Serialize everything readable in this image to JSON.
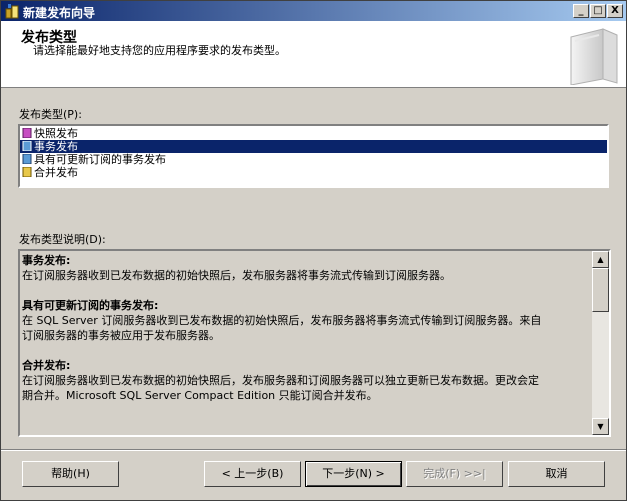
{
  "window": {
    "title": "新建发布向导",
    "controls": {
      "minimize": "_",
      "maximize": "□",
      "close": "X"
    }
  },
  "header": {
    "title": "发布类型",
    "subtitle": "请选择能最好地支持您的应用程序要求的发布类型。",
    "art_icon": "book-icon"
  },
  "publication_types": {
    "label": "发布类型(P):",
    "selected_index": 1,
    "items": [
      {
        "label": "快照发布",
        "icon": "snapshot-publication-icon"
      },
      {
        "label": "事务发布",
        "icon": "transactional-publication-icon"
      },
      {
        "label": "具有可更新订阅的事务发布",
        "icon": "updatable-transactional-publication-icon"
      },
      {
        "label": "合并发布",
        "icon": "merge-publication-icon"
      }
    ]
  },
  "description": {
    "label": "发布类型说明(D):",
    "sections": [
      {
        "heading": "事务发布:",
        "lines": [
          "在订阅服务器收到已发布数据的初始快照后，发布服务器将事务流式传输到订阅服务器。"
        ]
      },
      {
        "heading": "具有可更新订阅的事务发布:",
        "lines": [
          "在 SQL Server 订阅服务器收到已发布数据的初始快照后，发布服务器将事务流式传输到订阅服务器。来自",
          "订阅服务器的事务被应用于发布服务器。"
        ]
      },
      {
        "heading": "合并发布:",
        "lines": [
          "在订阅服务器收到已发布数据的初始快照后，发布服务器和订阅服务器可以独立更新已发布数据。更改会定",
          "期合并。Microsoft SQL Server Compact Edition 只能订阅合并发布。"
        ]
      }
    ]
  },
  "buttons": {
    "help": "帮助(H)",
    "back": "< 上一步(B)",
    "next": "下一步(N) >",
    "finish": "完成(F) >>|",
    "cancel": "取消"
  },
  "colors": {
    "title_bar_start": "#0a246a",
    "title_bar_end": "#a6caf0",
    "selection": "#0a246a",
    "dialog_face": "#d4d0c8"
  }
}
